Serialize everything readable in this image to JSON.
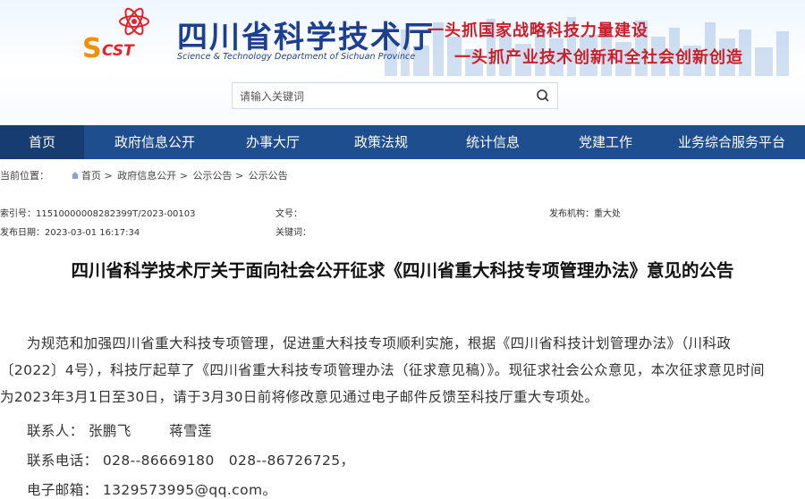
{
  "header": {
    "logo_text": "SCST",
    "org_name": "四川省科学技术厅",
    "org_name_en": "Science & Technology Department of Sichuan Province",
    "slogan_1": "一头抓国家战略科技力量建设",
    "slogan_2": "一头抓产业技术创新和全社会创新创造"
  },
  "search": {
    "placeholder": "请输入关键词"
  },
  "nav": {
    "items": [
      {
        "label": "首页"
      },
      {
        "label": "政府信息公开"
      },
      {
        "label": "办事大厅"
      },
      {
        "label": "政策法规"
      },
      {
        "label": "统计信息"
      },
      {
        "label": "党建工作"
      },
      {
        "label": "业务综合服务平台"
      }
    ]
  },
  "breadcrumb": {
    "prefix": "当前位置：",
    "items": [
      "首页",
      "政府信息公开",
      "公示公告",
      "公示公告"
    ],
    "separator": ">"
  },
  "meta": {
    "index_label": "索引号：",
    "index_value": "11510000008282399T/2023-00103",
    "doc_no_label": "文号：",
    "doc_no_value": "",
    "issuer_label": "发布机构：",
    "issuer_value": "重大处",
    "date_label": "发布日期：",
    "date_value": "2023-03-01 16:17:34",
    "keywords_label": "关键词：",
    "keywords_value": ""
  },
  "article": {
    "title": "四川省科学技术厅关于面向社会公开征求《四川省重大科技专项管理办法》意见的公告",
    "para_line_1": "为规范和加强四川省重大科技专项管理，促进重大科技专项顺利实施，根据《四川省科技计划管理办法》（川科政",
    "para_line_2": "〔2022〕4号），科技厅起草了《四川省重大科技专项管理办法（征求意见稿）》。现征求社会公众意见，本次征求意见时间",
    "para_line_3": "为2023年3月1日至30日，请于3月30日前将修改意见通过电子邮件反馈至科技厅重大专项处。",
    "contact_label": "联系人：",
    "contact_names": "张鹏飞        蒋雪莲",
    "phone_label": "联系电话：",
    "phone_values": "028--86669180   028--86726725，",
    "email_label": "电子邮箱：",
    "email_value": "1329573995@qq.com。"
  },
  "colors": {
    "nav_bg": "#1f4e8e",
    "brand_blue": "#1d3f8f",
    "slogan_red": "#c8202a"
  }
}
